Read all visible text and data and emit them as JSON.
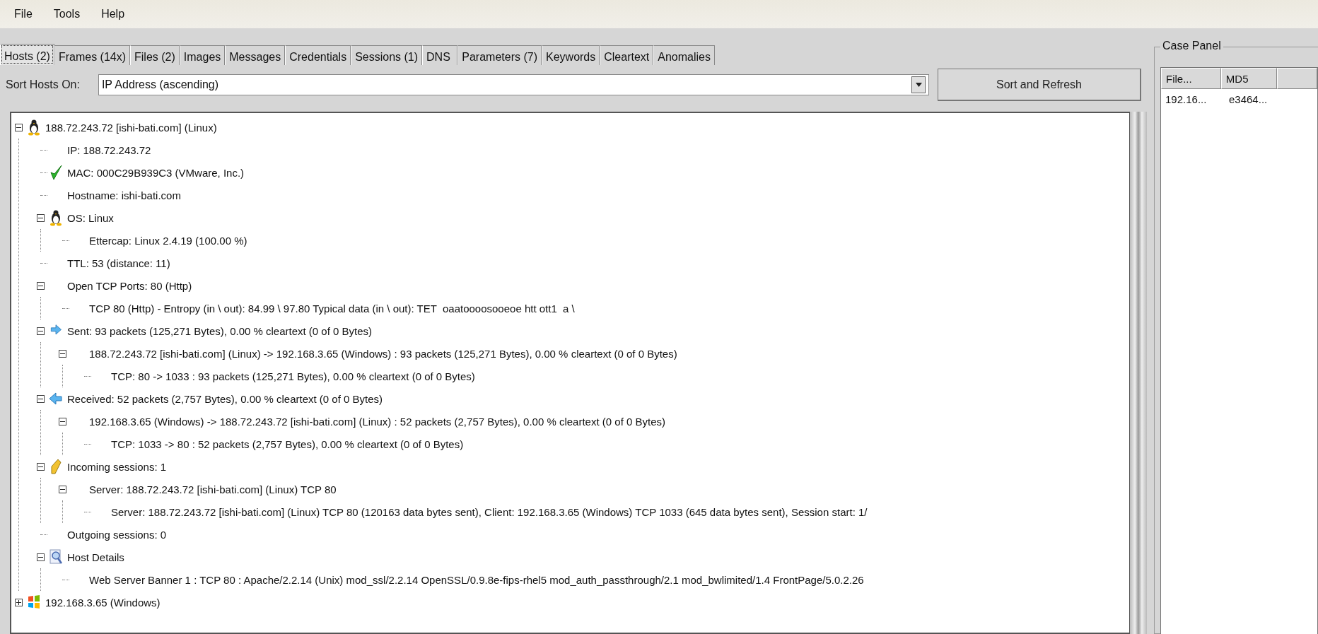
{
  "menu": [
    "File",
    "Tools",
    "Help"
  ],
  "tabs": [
    {
      "label": "Hosts (2)",
      "selected": true
    },
    {
      "label": "Frames (14x)",
      "selected": false
    },
    {
      "label": "Files (2)",
      "selected": false
    },
    {
      "label": "Images",
      "selected": false
    },
    {
      "label": "Messages",
      "selected": false
    },
    {
      "label": "Credentials",
      "selected": false
    },
    {
      "label": "Sessions (1)",
      "selected": false
    },
    {
      "label": "DNS ",
      "selected": false
    },
    {
      "label": "Parameters (7)",
      "selected": false
    },
    {
      "label": "Keywords",
      "selected": false
    },
    {
      "label": "Cleartext",
      "selected": false
    },
    {
      "label": "Anomalies",
      "selected": false
    }
  ],
  "sort": {
    "label": "Sort Hosts On:",
    "value": "IP Address (ascending)",
    "button": "Sort and Refresh"
  },
  "tree": [
    {
      "text": "188.72.243.72 [ishi-bati.com] (Linux)",
      "kind": "linux",
      "expanded": true,
      "children": [
        {
          "text": "IP: 188.72.243.72"
        },
        {
          "text": "MAC: 000C29B939C3 (VMware, Inc.)",
          "kind": "mac"
        },
        {
          "text": "Hostname: ishi-bati.com"
        },
        {
          "text": "OS: Linux",
          "kind": "linux",
          "expanded": true,
          "children": [
            {
              "text": "Ettercap: Linux 2.4.19 (100.00 %)"
            }
          ]
        },
        {
          "text": "TTL: 53 (distance: 11)"
        },
        {
          "text": "Open TCP Ports: 80 (Http)",
          "expanded": true,
          "children": [
            {
              "text": "TCP 80 (Http) - Entropy (in \\ out): 84.99 \\ 97.80 Typical data (in \\ out): TET  oaatoooosooeoe htt ott1  a \\"
            }
          ]
        },
        {
          "text": "Sent: 93 packets (125,271 Bytes), 0.00 % cleartext (0 of 0 Bytes)",
          "kind": "sent",
          "expanded": true,
          "children": [
            {
              "text": "188.72.243.72 [ishi-bati.com] (Linux) -> 192.168.3.65 (Windows) : 93 packets (125,271 Bytes), 0.00 % cleartext (0 of 0 Bytes)",
              "expanded": true,
              "children": [
                {
                  "text": "TCP: 80 -> 1033 : 93 packets (125,271 Bytes), 0.00 % cleartext (0 of 0 Bytes)"
                }
              ]
            }
          ]
        },
        {
          "text": "Received: 52 packets (2,757 Bytes), 0.00 % cleartext (0 of 0 Bytes)",
          "kind": "received",
          "expanded": true,
          "children": [
            {
              "text": "192.168.3.65 (Windows) -> 188.72.243.72 [ishi-bati.com] (Linux) : 52 packets (2,757 Bytes), 0.00 % cleartext (0 of 0 Bytes)",
              "expanded": true,
              "children": [
                {
                  "text": "TCP: 1033 -> 80 : 52 packets (2,757 Bytes), 0.00 % cleartext (0 of 0 Bytes)"
                }
              ]
            }
          ]
        },
        {
          "text": "Incoming sessions: 1",
          "kind": "sessions",
          "expanded": true,
          "children": [
            {
              "text": "Server: 188.72.243.72 [ishi-bati.com] (Linux) TCP 80",
              "expanded": true,
              "children": [
                {
                  "text": "Server: 188.72.243.72 [ishi-bati.com] (Linux) TCP 80 (120163 data bytes sent), Client: 192.168.3.65 (Windows) TCP 1033 (645 data bytes sent), Session start: 1/"
                }
              ]
            }
          ]
        },
        {
          "text": "Outgoing sessions: 0"
        },
        {
          "text": "Host Details",
          "kind": "details",
          "expanded": true,
          "children": [
            {
              "text": "Web Server Banner 1 : TCP 80 : Apache/2.2.14 (Unix) mod_ssl/2.2.14 OpenSSL/0.9.8e-fips-rhel5 mod_auth_passthrough/2.1 mod_bwlimited/1.4 FrontPage/5.0.2.26"
            }
          ]
        }
      ]
    },
    {
      "text": "192.168.3.65 (Windows)",
      "kind": "windows",
      "expanded": false
    }
  ],
  "case_panel": {
    "title": "Case Panel",
    "columns": [
      "File...",
      "MD5"
    ],
    "rows": [
      [
        "192.16...",
        "e3464..."
      ]
    ]
  }
}
